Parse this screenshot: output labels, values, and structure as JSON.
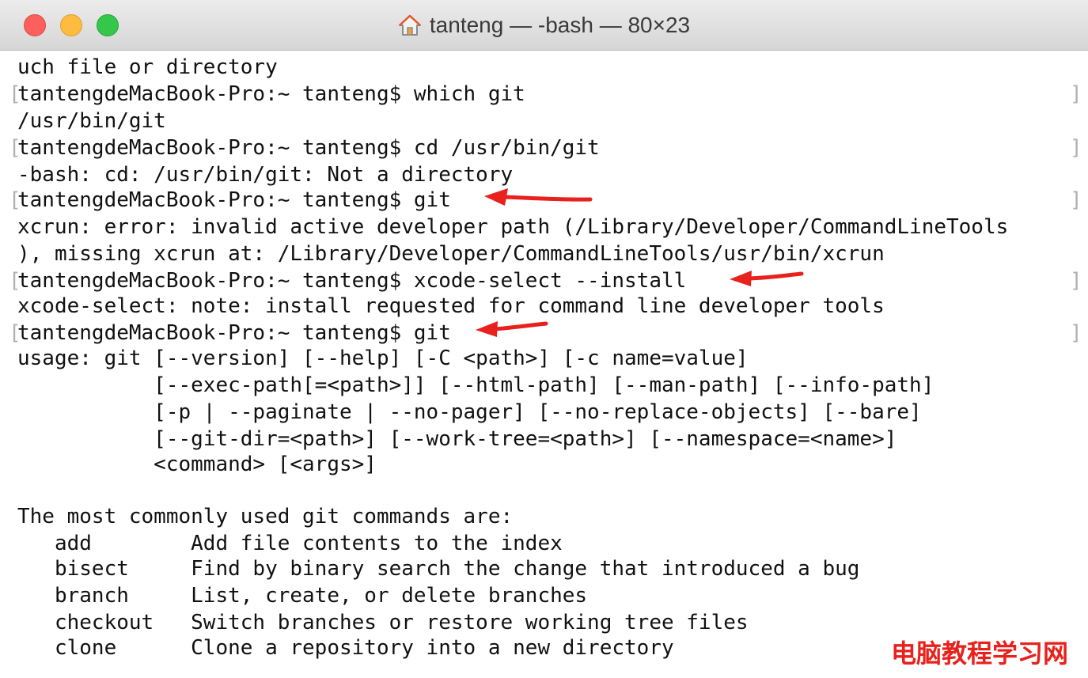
{
  "window": {
    "title": "tanteng — -bash — 80×23"
  },
  "terminal": {
    "lines": [
      "uch file or directory",
      "tantengdeMacBook-Pro:~ tanteng$ which git",
      "/usr/bin/git",
      "tantengdeMacBook-Pro:~ tanteng$ cd /usr/bin/git",
      "-bash: cd: /usr/bin/git: Not a directory",
      "tantengdeMacBook-Pro:~ tanteng$ git",
      "xcrun: error: invalid active developer path (/Library/Developer/CommandLineTools",
      "), missing xcrun at: /Library/Developer/CommandLineTools/usr/bin/xcrun",
      "tantengdeMacBook-Pro:~ tanteng$ xcode-select --install",
      "xcode-select: note: install requested for command line developer tools",
      "tantengdeMacBook-Pro:~ tanteng$ git",
      "usage: git [--version] [--help] [-C <path>] [-c name=value]",
      "           [--exec-path[=<path>]] [--html-path] [--man-path] [--info-path]",
      "           [-p | --paginate | --no-pager] [--no-replace-objects] [--bare]",
      "           [--git-dir=<path>] [--work-tree=<path>] [--namespace=<name>]",
      "           <command> [<args>]",
      "",
      "The most commonly used git commands are:",
      "   add        Add file contents to the index",
      "   bisect     Find by binary search the change that introduced a bug",
      "   branch     List, create, or delete branches",
      "   checkout   Switch branches or restore working tree files",
      "   clone      Clone a repository into a new directory"
    ],
    "bracket_left": "[",
    "bracket_right": "]"
  },
  "watermark": "电脑教程学习网",
  "colors": {
    "arrow": "#e8211c",
    "watermark": "#e8211c",
    "close": "#fc605c",
    "minimize": "#fdbc40",
    "maximize": "#34c749"
  },
  "icons": {
    "title_icon": "home-icon",
    "annotation": "red-arrow-icon"
  }
}
